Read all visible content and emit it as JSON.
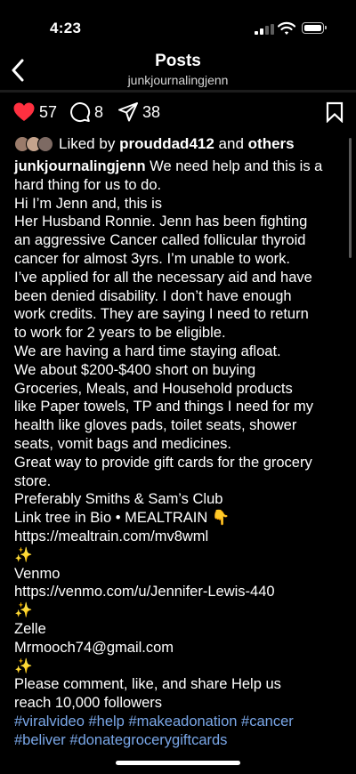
{
  "status": {
    "time": "4:23"
  },
  "header": {
    "title": "Posts",
    "username": "junkjournalingjenn"
  },
  "actions": {
    "likes": "57",
    "comments": "8",
    "shares": "38"
  },
  "liked_by": {
    "prefix": "Liked by",
    "user": "prouddad412",
    "conj": "and",
    "others": "others"
  },
  "caption": {
    "author": "junkjournalingjenn",
    "first_line_rest": " We need help and this is a",
    "lines": [
      "hard thing for us to do.",
      "Hi I’m Jenn and, this is",
      "Her Husband Ronnie. Jenn has been fighting",
      "an aggressive Cancer called follicular thyroid",
      "cancer for almost 3yrs. I’m unable to work.",
      "I’ve applied for all the necessary aid and have",
      "been denied disability. I don’t have enough",
      "work credits. They are saying I need to return",
      "to work for 2 years to be eligible.",
      "We are having a hard time staying afloat.",
      "We about $200-$400 short on buying",
      "Groceries, Meals, and Household products",
      "like Paper towels, TP and things I need for my",
      "health like gloves pads, toilet seats, shower",
      "seats, vomit bags and medicines.",
      "Great way to provide gift cards for the grocery",
      "store.",
      "Preferably Smiths & Sam’s Club",
      "Link tree in Bio • MEALTRAIN 👇",
      "https://mealtrain.com/mv8wml",
      "✨",
      "Venmo",
      "https://venmo.com/u/Jennifer-Lewis-440",
      "✨",
      "Zelle",
      "Mrmooch74@gmail.com",
      "✨",
      "Please comment, like, and share Help us",
      "reach 10,000 followers"
    ],
    "hashtags_line1": [
      "#viralvideo",
      "#help",
      "#makeadonation",
      "#cancer"
    ],
    "hashtags_line2": [
      "#beliver",
      "#donategrocerygiftcards"
    ]
  },
  "colors": {
    "like_red": "#ff3040",
    "hashtag_blue": "#7aa7e8",
    "background": "#000000"
  }
}
